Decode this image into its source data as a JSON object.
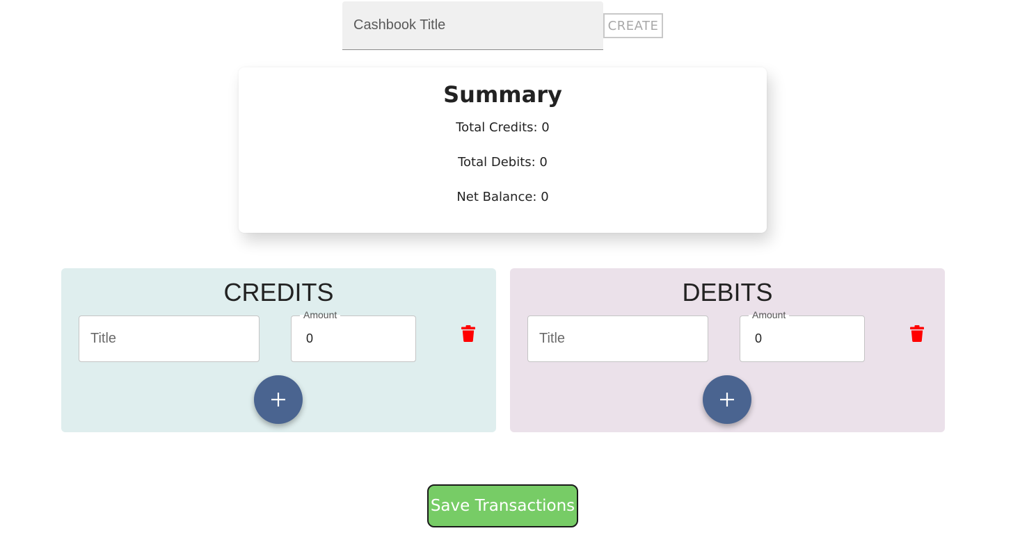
{
  "header": {
    "title_placeholder": "Cashbook Title",
    "create_label": "CREATE"
  },
  "summary": {
    "heading": "Summary",
    "total_credits": "Total Credits: 0",
    "total_debits": "Total Debits: 0",
    "net_balance": "Net Balance: 0"
  },
  "credits": {
    "heading": "CREDITS",
    "rows": [
      {
        "title_placeholder": "Title",
        "amount_label": "Amount",
        "amount_value": "0"
      }
    ],
    "add_icon": "plus-icon",
    "delete_icon": "trash-icon"
  },
  "debits": {
    "heading": "DEBITS",
    "rows": [
      {
        "title_placeholder": "Title",
        "amount_label": "Amount",
        "amount_value": "0"
      }
    ],
    "add_icon": "plus-icon",
    "delete_icon": "trash-icon"
  },
  "footer": {
    "save_label": "Save Transactions"
  },
  "colors": {
    "credits_bg": "#dfeeee",
    "debits_bg": "#ebe1ea",
    "fab": "#4a6490",
    "save_button": "#77cc66",
    "delete_icon": "#ff0000"
  }
}
